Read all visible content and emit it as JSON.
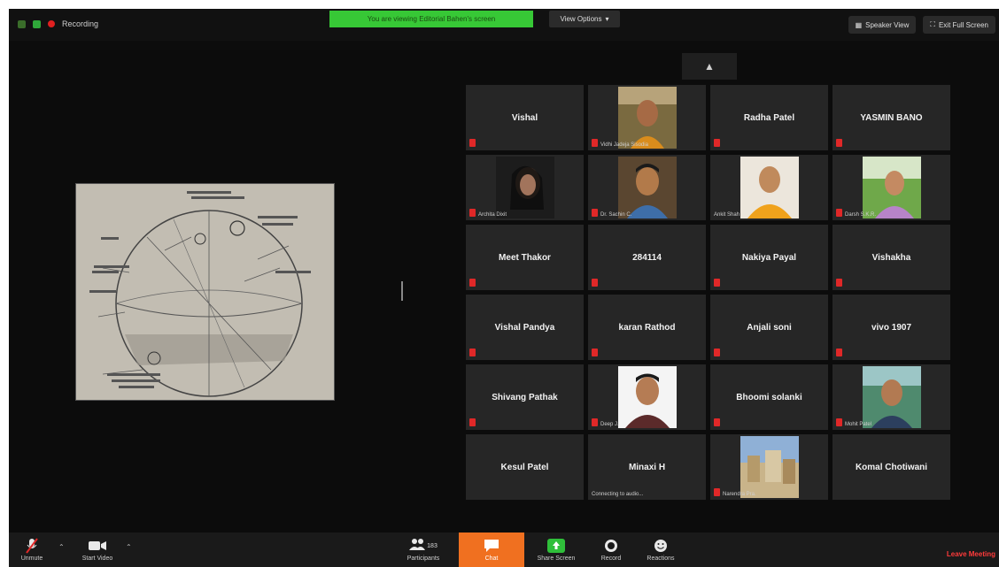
{
  "top_bar": {
    "recording_label": "Recording",
    "share_banner": "You are viewing Editorial Bahen's screen",
    "view_options": "View Options",
    "speaker_view": "Speaker View",
    "full_screen": "Exit Full Screen"
  },
  "participants": [
    {
      "name": "Vishal",
      "video": false
    },
    {
      "name": "Vidhi Jadeja Sisodia",
      "video": true
    },
    {
      "name": "Radha Patel",
      "video": false
    },
    {
      "name": "YASMIN BANO",
      "video": false
    },
    {
      "name": "Archita Dixit",
      "video": true
    },
    {
      "name": "Dr. Sachin C.",
      "video": true
    },
    {
      "name": "Ankit Shah",
      "video": true
    },
    {
      "name": "Darsh S.K.R.",
      "video": true
    },
    {
      "name": "Meet Thakor",
      "video": false
    },
    {
      "name": "284114",
      "video": false
    },
    {
      "name": "Nakiya Payal",
      "video": false
    },
    {
      "name": "Vishakha",
      "video": false
    },
    {
      "name": "Vishal Pandya",
      "video": false
    },
    {
      "name": "karan Rathod",
      "video": false
    },
    {
      "name": "Anjali soni",
      "video": false
    },
    {
      "name": "vivo 1907",
      "video": false
    },
    {
      "name": "Shivang Pathak",
      "video": false
    },
    {
      "name": "Deep J.",
      "video": true
    },
    {
      "name": "Bhoomi solanki",
      "video": false
    },
    {
      "name": "Mohit Patel",
      "video": true
    },
    {
      "name": "Kesul Patel",
      "video": false
    },
    {
      "name": "Minaxi H",
      "video": false,
      "status": "Connecting to audio..."
    },
    {
      "name": "Narendra Pra.",
      "video": true
    },
    {
      "name": "Komal Chotiwani",
      "video": false
    }
  ],
  "toolbar": {
    "unmute": "Unmute",
    "start_video": "Start Video",
    "participants": "Participants",
    "participant_count": "183",
    "chat": "Chat",
    "share_screen": "Share Screen",
    "record": "Record",
    "reactions": "Reactions",
    "leave": "Leave Meeting"
  },
  "colors": {
    "banner_green": "#37c836",
    "chat_orange": "#f07020",
    "mute_red": "#e02828",
    "leave_red": "#ff3b3b"
  }
}
